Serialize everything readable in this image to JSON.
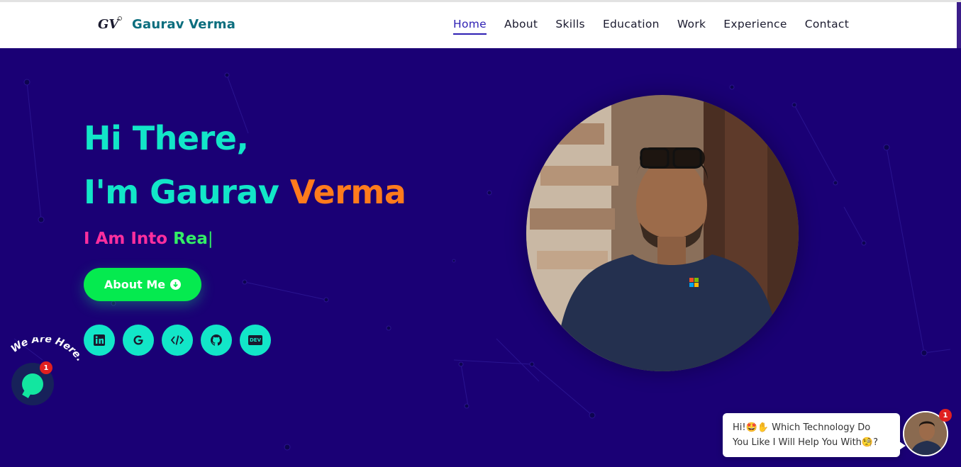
{
  "header": {
    "brand_name": "Gaurav Verma",
    "logo_text": "GV",
    "nav": [
      {
        "label": "Home",
        "active": true
      },
      {
        "label": "About",
        "active": false
      },
      {
        "label": "Skills",
        "active": false
      },
      {
        "label": "Education",
        "active": false
      },
      {
        "label": "Work",
        "active": false
      },
      {
        "label": "Experience",
        "active": false
      },
      {
        "label": "Contact",
        "active": false
      }
    ]
  },
  "hero": {
    "greeting": "Hi There,",
    "intro_prefix": "I'm Gaurav ",
    "intro_accent": "Verma",
    "typing_prefix": "I Am Into ",
    "typing_word": "Rea",
    "typing_cursor": "|",
    "about_button": "About Me",
    "socials": [
      "linkedin-icon",
      "google-icon",
      "code-icon",
      "github-icon",
      "dev-icon"
    ],
    "dev_label": "DEV"
  },
  "chat_widget": {
    "we_are_here": "We Are Here!",
    "unread_badge": "1",
    "message_line1": "Hi!🤩✋ Which Technology Do",
    "message_line2": "You Like I Will Help You With🧐?",
    "avatar_badge": "1"
  },
  "colors": {
    "hero_bg": "#1a0075",
    "teal": "#12e6c8",
    "orange": "#ff7b1c",
    "pink": "#ff2f9e",
    "green": "#05ea4f",
    "nav_active": "#2d1fb3"
  }
}
